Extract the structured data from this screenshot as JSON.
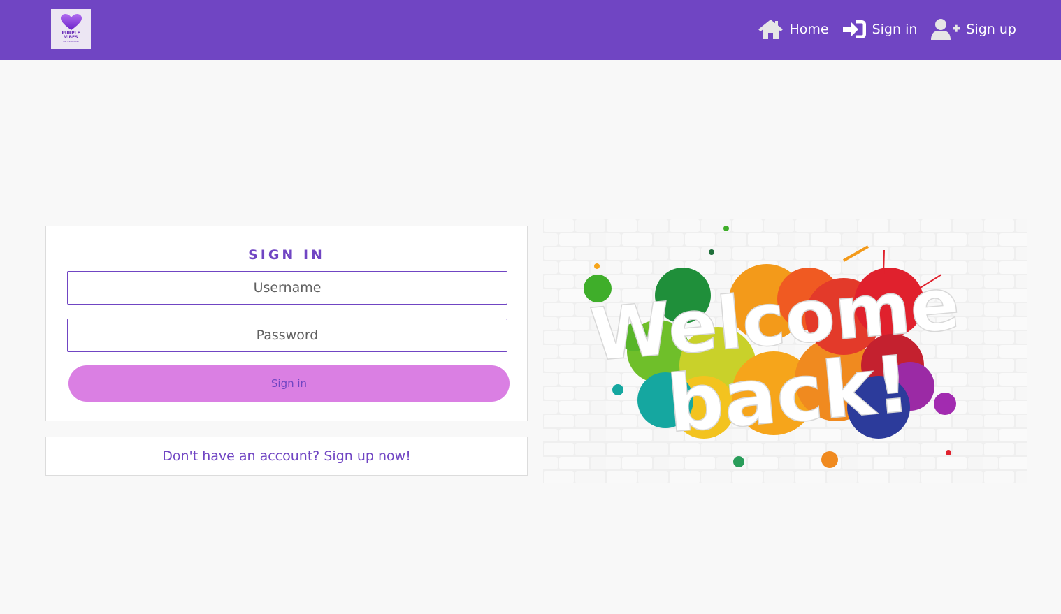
{
  "navbar": {
    "brand_color": "#7045c3",
    "logo": {
      "icon": "heart-icon",
      "title": "PURPLE VIBES",
      "subtitle": "FOR THE MEMORY"
    },
    "links": [
      {
        "label": "Home",
        "icon": "home-icon"
      },
      {
        "label": "Sign in",
        "icon": "sign-in-icon"
      },
      {
        "label": "Sign up",
        "icon": "user-plus-icon"
      }
    ]
  },
  "signin": {
    "heading": "SIGN IN",
    "username_placeholder": "Username",
    "password_placeholder": "Password",
    "button_label": "Sign in",
    "button_color": "#da7fe3"
  },
  "signup_prompt": {
    "text": "Don't have an account?",
    "link": "Sign up now!"
  },
  "hero_image": {
    "line1": "Welcome",
    "line2": "back!"
  }
}
